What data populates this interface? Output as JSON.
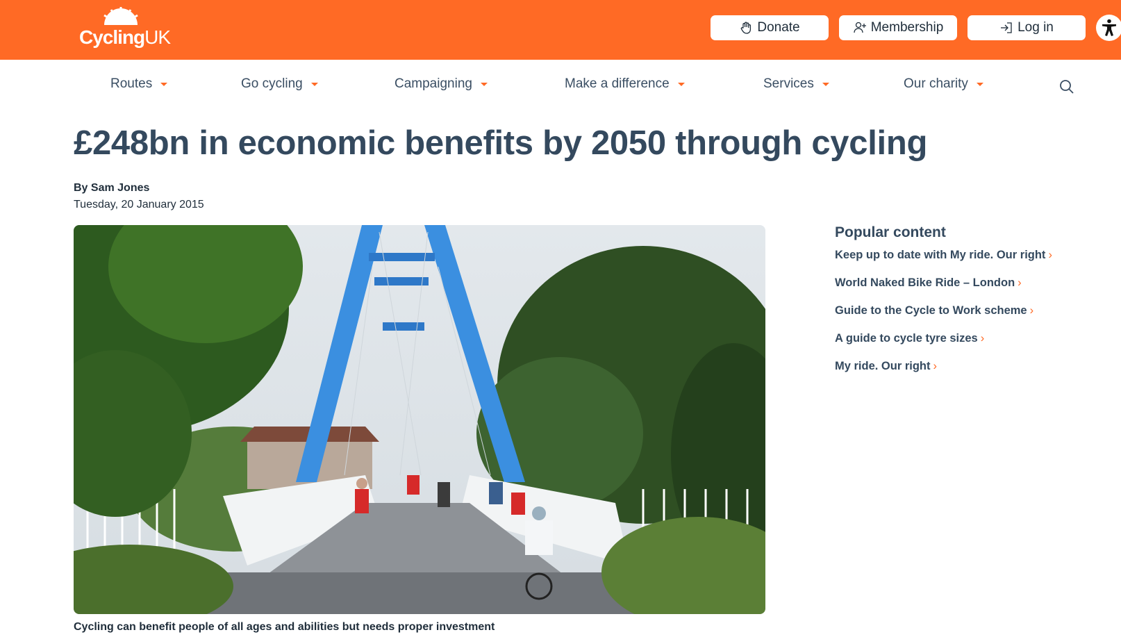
{
  "brand": {
    "name": "Cycling",
    "suffix": "UK",
    "accent": "#ff6a25",
    "text_color": "#34495e"
  },
  "top_actions": {
    "donate": "Donate",
    "membership": "Membership",
    "login": "Log in"
  },
  "nav": {
    "items": [
      {
        "label": "Routes"
      },
      {
        "label": "Go cycling"
      },
      {
        "label": "Campaigning"
      },
      {
        "label": "Make a difference"
      },
      {
        "label": "Services"
      },
      {
        "label": "Our charity"
      }
    ]
  },
  "article": {
    "title": "£248bn in economic benefits by 2050 through cycling",
    "byline": "By Sam Jones",
    "date": "Tuesday, 20 January 2015",
    "caption": "Cycling can benefit people of all ages and abilities but needs proper investment"
  },
  "sidebar": {
    "title": "Popular content",
    "items": [
      {
        "label": "Keep up to date with My ride. Our right"
      },
      {
        "label": "World Naked Bike Ride – London"
      },
      {
        "label": "Guide to the Cycle to Work scheme"
      },
      {
        "label": "A guide to cycle tyre sizes"
      },
      {
        "label": "My ride. Our right"
      }
    ]
  }
}
